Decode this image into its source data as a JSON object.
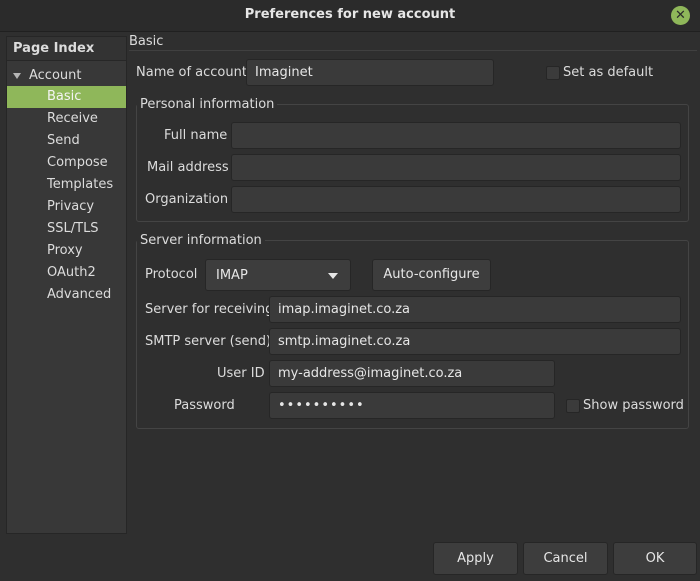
{
  "window": {
    "title": "Preferences for new account"
  },
  "sidebar": {
    "header": "Page Index",
    "group": "Account",
    "items": [
      "Basic",
      "Receive",
      "Send",
      "Compose",
      "Templates",
      "Privacy",
      "SSL/TLS",
      "Proxy",
      "OAuth2",
      "Advanced"
    ],
    "selected": "Basic"
  },
  "page": {
    "section_title": "Basic",
    "name_of_account_label": "Name of account",
    "name_of_account_value": "Imaginet",
    "set_as_default_label": "Set as default"
  },
  "personal": {
    "title": "Personal information",
    "full_name_label": "Full name",
    "full_name_value": "",
    "mail_address_label": "Mail address",
    "mail_address_value": "",
    "organization_label": "Organization",
    "organization_value": ""
  },
  "server": {
    "title": "Server information",
    "protocol_label": "Protocol",
    "protocol_value": "IMAP",
    "auto_configure_label": "Auto-configure",
    "server_receiving_label": "Server for receiving",
    "server_receiving_value": "imap.imaginet.co.za",
    "smtp_label": "SMTP server (send)",
    "smtp_value": "smtp.imaginet.co.za",
    "user_id_label": "User ID",
    "user_id_value": "my-address@imaginet.co.za",
    "password_label": "Password",
    "password_value": "••••••••••",
    "show_password_label": "Show password"
  },
  "footer": {
    "apply": "Apply",
    "cancel": "Cancel",
    "ok": "OK"
  },
  "colors": {
    "accent": "#8fb75a",
    "background": "#2f2f2f",
    "input_background": "#3a3a3a"
  }
}
